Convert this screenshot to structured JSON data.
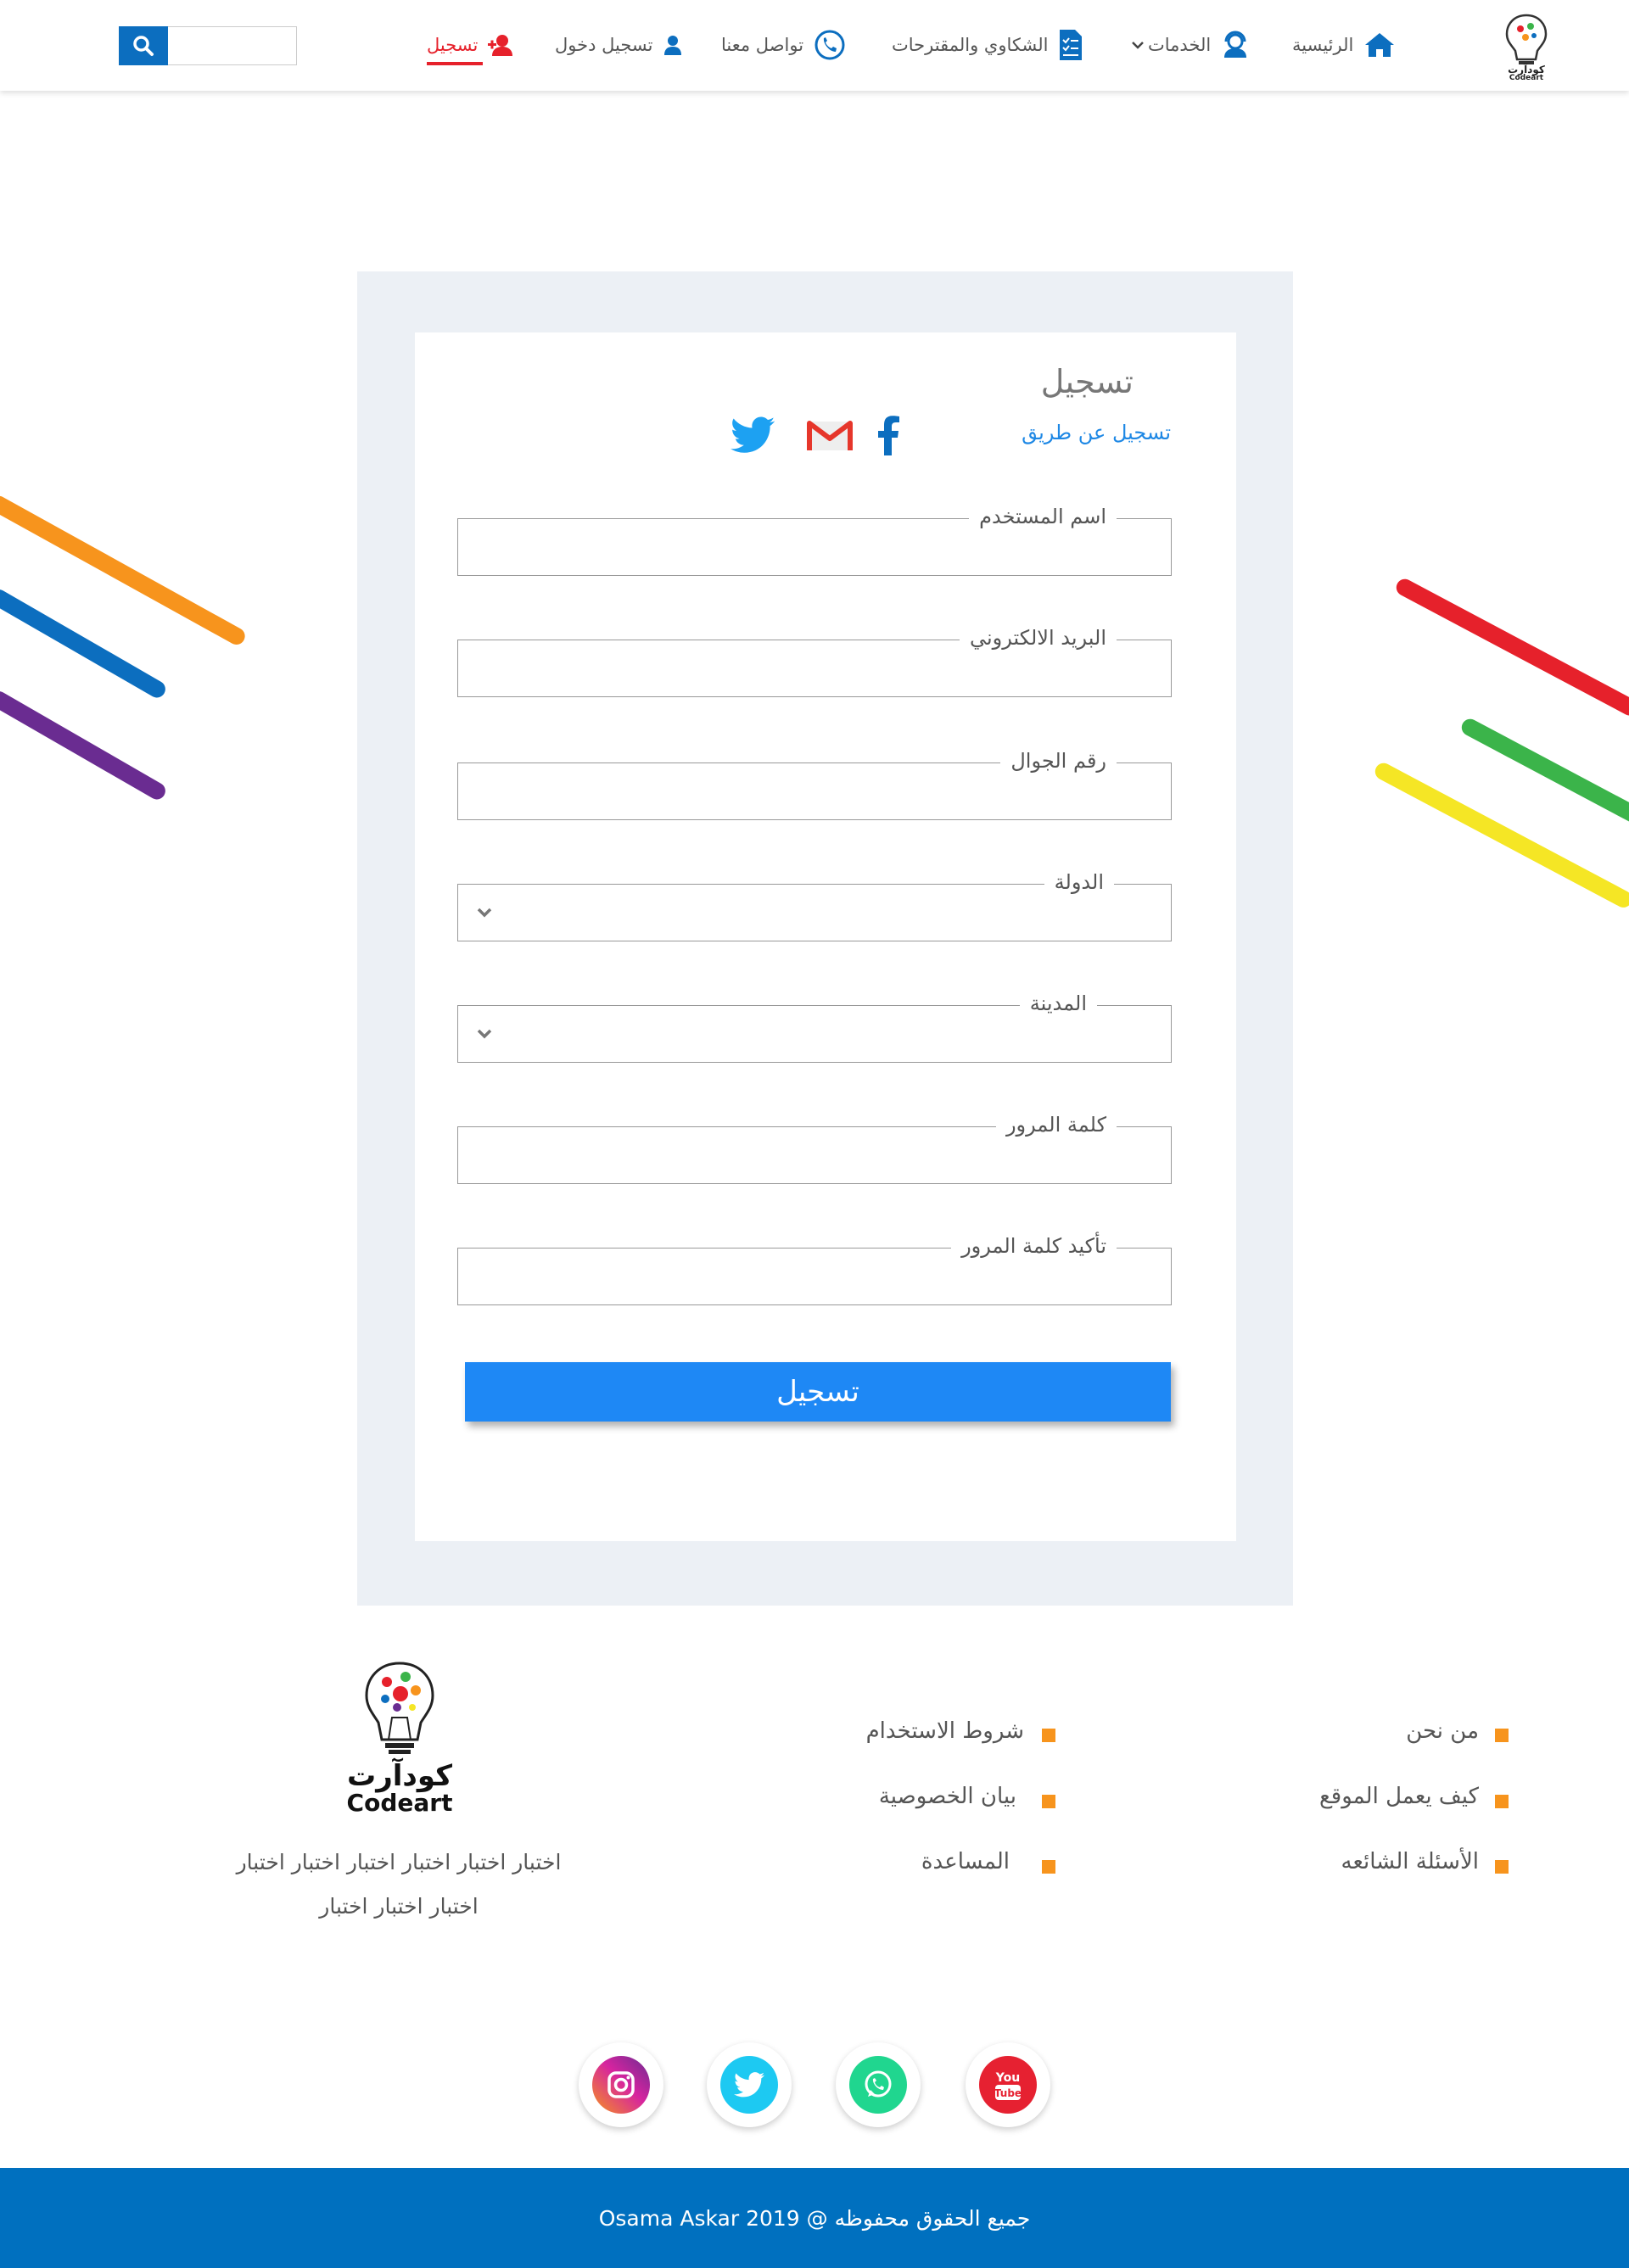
{
  "colors": {
    "primary_blue": "#0c6ebf",
    "active_red": "#e6212b",
    "button_blue": "#1e88f5",
    "card_bg": "#ecf0f5",
    "bullet_orange": "#f7941d",
    "footer_bar": "#0070bf"
  },
  "nav": {
    "logo_text": "كودآرت",
    "logo_subtext": "Codeart",
    "items": [
      {
        "label": "الرئيسية",
        "icon": "home-icon"
      },
      {
        "label": "الخدمات",
        "icon": "support-agent-icon"
      },
      {
        "label": "الشكاوي والمقترحات",
        "icon": "clipboard-icon"
      },
      {
        "label": "تواصل معنا",
        "icon": "phone-icon"
      },
      {
        "label": "تسجيل دخول",
        "icon": "user-icon"
      },
      {
        "label": "تسجيل",
        "icon": "add-user-icon",
        "active": true
      }
    ],
    "search_placeholder": ""
  },
  "form": {
    "title": "تسجيل",
    "social_label": "تسجيل عن طريق",
    "social_icons": [
      "facebook-icon",
      "gmail-icon",
      "twitter-icon"
    ],
    "fields": [
      {
        "label": "اسم المستخدم",
        "type": "text",
        "value": ""
      },
      {
        "label": "البريد الالكتروني",
        "type": "text",
        "value": ""
      },
      {
        "label": "رقم الجوال",
        "type": "text",
        "value": ""
      },
      {
        "label": "الدولة",
        "type": "select",
        "value": ""
      },
      {
        "label": "المدينة",
        "type": "select",
        "value": ""
      },
      {
        "label": "كلمة المرور",
        "type": "password",
        "value": ""
      },
      {
        "label": "تأكيد كلمة المرور",
        "type": "password",
        "value": ""
      }
    ],
    "submit_label": "تسجيل"
  },
  "footer": {
    "logo_text": "كودآرت",
    "logo_subtext": "Codeart",
    "description_line1": "اختبار اختبار اختبار اختبار اختبار اختبار",
    "description_line2": "اختبار اختبار اختبار",
    "links_col1": [
      "من نحن",
      "كيف يعمل الموقع",
      "الأسئلة الشائعه"
    ],
    "links_col2": [
      "شروط الاستخدام",
      "بيان الخصوصية",
      "المساعدة"
    ],
    "social": [
      "youtube-icon",
      "whatsapp-icon",
      "twitter-icon",
      "instagram-icon"
    ],
    "copyright": "جميع الحقوق محفوظه @ 2019 Osama Askar"
  }
}
